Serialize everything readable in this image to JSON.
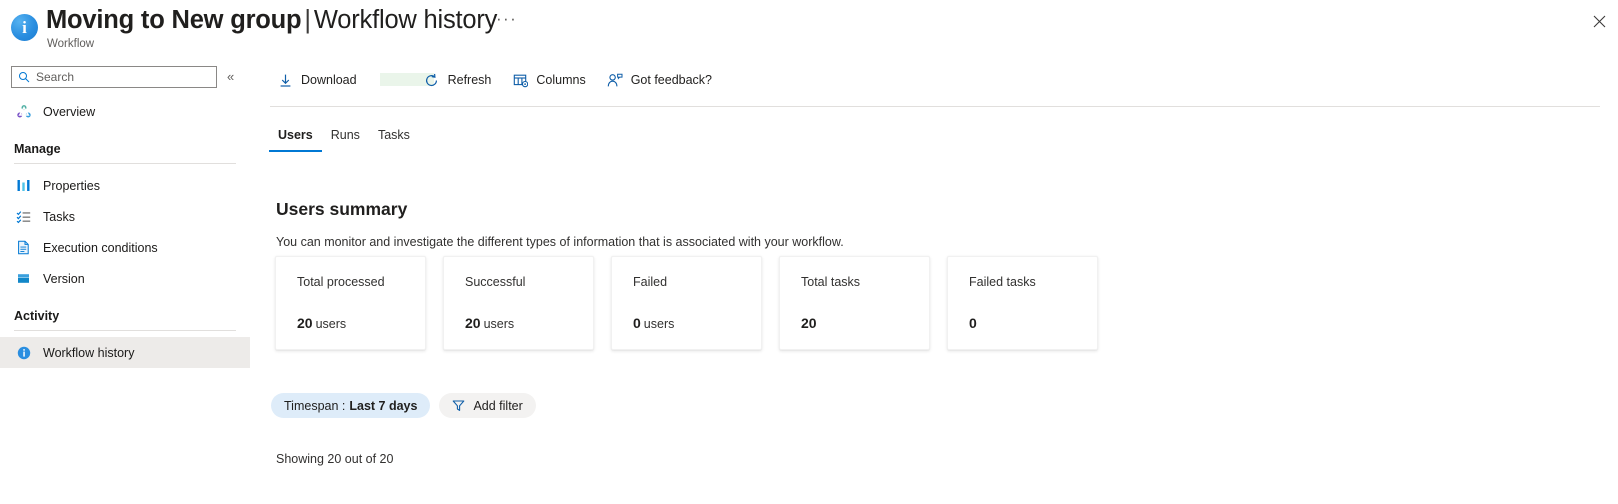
{
  "header": {
    "icon": "info-circle-icon",
    "title_bold": "Moving to New group",
    "title_separator": "|",
    "title_light": "Workflow history",
    "subtitle": "Workflow",
    "ellipsis": "···",
    "close_label": "Close",
    "accent_color": "#0078d4"
  },
  "sidebar": {
    "search": {
      "placeholder": "Search",
      "value": "",
      "icon": "search-icon"
    },
    "collapse": {
      "icon": "chevron-double-left-icon",
      "label": "«"
    },
    "top_items": [
      {
        "label": "Overview",
        "icon": "overview-icon",
        "selected": false
      }
    ],
    "sections": [
      {
        "label": "Manage",
        "items": [
          {
            "label": "Properties",
            "icon": "properties-bars-icon",
            "selected": false
          },
          {
            "label": "Tasks",
            "icon": "tasks-checklist-icon",
            "selected": false
          },
          {
            "label": "Execution conditions",
            "icon": "document-icon",
            "selected": false
          },
          {
            "label": "Version",
            "icon": "version-layers-icon",
            "selected": false
          }
        ]
      },
      {
        "label": "Activity",
        "items": [
          {
            "label": "Workflow history",
            "icon": "info-circle-icon",
            "selected": true
          }
        ]
      }
    ]
  },
  "toolbar": {
    "items": [
      {
        "label": "Download",
        "icon": "download-icon"
      },
      {
        "label": "Refresh",
        "icon": "refresh-icon"
      },
      {
        "label": "Columns",
        "icon": "columns-icon"
      },
      {
        "label": "Got feedback?",
        "icon": "feedback-person-icon"
      }
    ]
  },
  "tabs": [
    {
      "label": "Users",
      "active": true
    },
    {
      "label": "Runs",
      "active": false
    },
    {
      "label": "Tasks",
      "active": false
    }
  ],
  "main": {
    "section_title": "Users summary",
    "section_description": "You can monitor and investigate the different types of information that is associated with your workflow.",
    "cards": [
      {
        "title": "Total processed",
        "value": "20",
        "unit": "users"
      },
      {
        "title": "Successful",
        "value": "20",
        "unit": "users"
      },
      {
        "title": "Failed",
        "value": "0",
        "unit": "users"
      },
      {
        "title": "Total tasks",
        "value": "20",
        "unit": ""
      },
      {
        "title": "Failed tasks",
        "value": "0",
        "unit": ""
      }
    ],
    "filters": {
      "timespan_key": "Timespan :",
      "timespan_value": "Last 7 days",
      "add_filter_label": "Add filter",
      "add_filter_icon": "funnel-icon"
    },
    "showing": "Showing 20 out of 20"
  }
}
